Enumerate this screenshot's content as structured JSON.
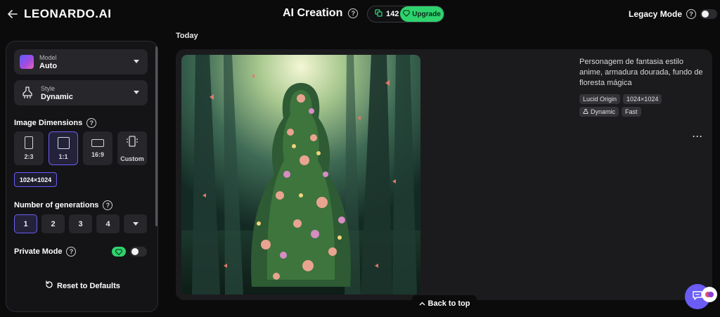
{
  "header": {
    "logo": "LEONARDO.AI",
    "title": "AI Creation",
    "token_count": "142",
    "upgrade_label": "Upgrade",
    "legacy_label": "Legacy Mode"
  },
  "sidebar": {
    "model": {
      "small": "Model",
      "value": "Auto"
    },
    "style": {
      "small": "Style",
      "value": "Dynamic"
    },
    "image_dimensions_label": "Image Dimensions",
    "dimensions": [
      {
        "label": "2:3",
        "active": false
      },
      {
        "label": "1:1",
        "active": true
      },
      {
        "label": "16:9",
        "active": false
      },
      {
        "label": "Custom",
        "active": false
      }
    ],
    "size_chip": "1024×1024",
    "generations_label": "Number of generations",
    "generations": [
      "1",
      "2",
      "3",
      "4"
    ],
    "selected_generations": "1",
    "private_mode_label": "Private Mode",
    "reset_label": "Reset to Defaults"
  },
  "main": {
    "section_label": "Today",
    "prompt": "Personagem de fantasia estilo anime, armadura dourada, fundo de floresta mágica",
    "tags_row1": [
      "Lucid Origin",
      "1024×1024"
    ],
    "tags_row2": [
      "Dynamic",
      "Fast"
    ],
    "more_label": "···",
    "back_to_top": "Back to top"
  },
  "colors": {
    "accent": "#6b5cf6",
    "upgrade_green": "#2fd36e",
    "background": "#0b0b0c",
    "panel": "#141416"
  }
}
